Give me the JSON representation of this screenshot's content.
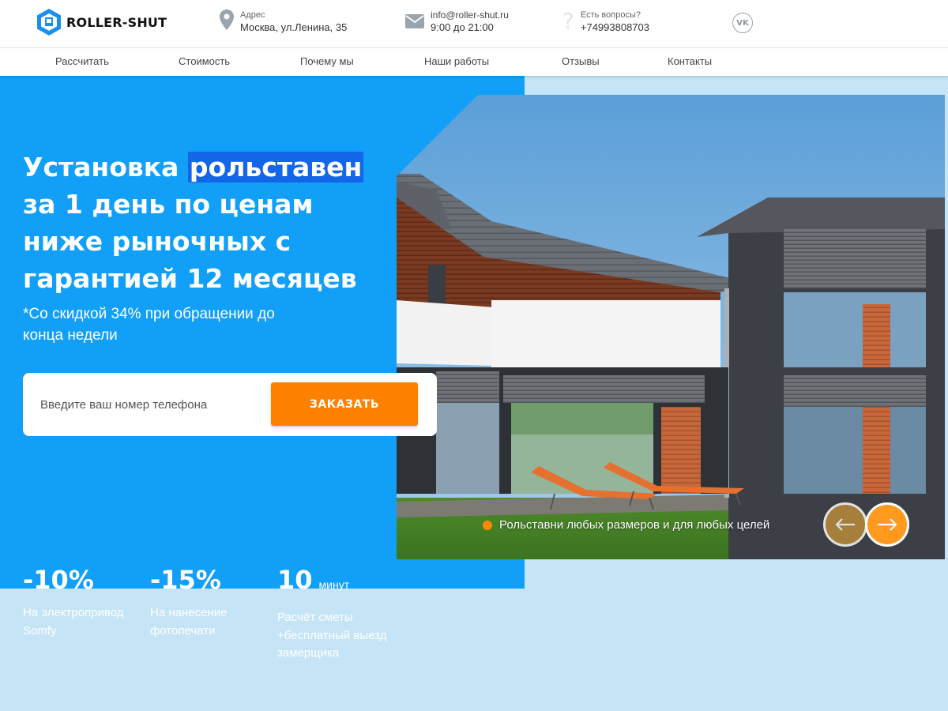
{
  "header": {
    "logo_text": "ROLLER-SHUT",
    "address": {
      "label": "Адрес",
      "value": "Москва, ул.Ленина, 35",
      "icon": "location-pin-icon"
    },
    "contact": {
      "email": "info@roller-shut.ru",
      "hours": "9:00 до 21:00",
      "icon": "envelope-icon"
    },
    "questions": {
      "label": "Есть вопросы?",
      "phone": "+74993808703",
      "icon": "question-icon"
    },
    "social": {
      "vk": "VK"
    }
  },
  "nav": [
    "Рассчитать",
    "Стоимость",
    "Почему мы",
    "Наши работы",
    "Отзывы",
    "Контакты"
  ],
  "hero": {
    "title_before": "Установка ",
    "title_highlight": "рольставен",
    "title_after": " за 1 день по ценам ниже рыночных с гарантией 12 месяцев",
    "subtitle": "*Со скидкой 34% при обращении до конца недели",
    "form": {
      "placeholder": "Введите ваш номер телефона",
      "button": "ЗАКАЗАТЬ"
    },
    "stats": [
      {
        "value": "-10%",
        "unit": "",
        "desc": "На электропривод Somfy"
      },
      {
        "value": "-15%",
        "unit": "",
        "desc": "На нанесение фотопечати"
      },
      {
        "value": "10",
        "unit": "минут",
        "desc": "Расчёт сметы +бесплатный выезд замерщика"
      }
    ]
  },
  "slider": {
    "caption": "Рольставни любых размеров и для любых целей",
    "prev_icon": "arrow-left-icon",
    "next_icon": "arrow-right-icon"
  },
  "colors": {
    "primary_blue": "#129ff7",
    "highlight_blue": "#1466e8",
    "accent_orange": "#ff8100",
    "page_bg": "#c5e5f7"
  }
}
